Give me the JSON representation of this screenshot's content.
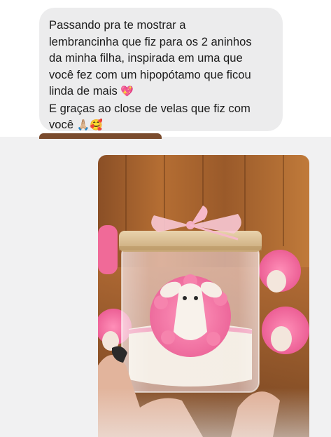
{
  "message": {
    "lines": [
      "Passando pra te mostrar a",
      "lembrancinha que fiz para os 2 aninhos",
      "da minha filha, inspirada em uma que",
      "você fez com um hipopótamo  que ficou",
      "linda de mais"
    ],
    "line5_emoji": "💖",
    "lines2": [
      "E graças ao close de velas que fiz com",
      "você"
    ],
    "line7_emojis": "🙏🏼🥰"
  },
  "colors": {
    "bubble": "#ececed",
    "text": "#1b1b1b",
    "background": "#f1f1f2"
  },
  "attachment": {
    "type": "photo",
    "subject": "candle-jar-with-pink-sheep"
  }
}
